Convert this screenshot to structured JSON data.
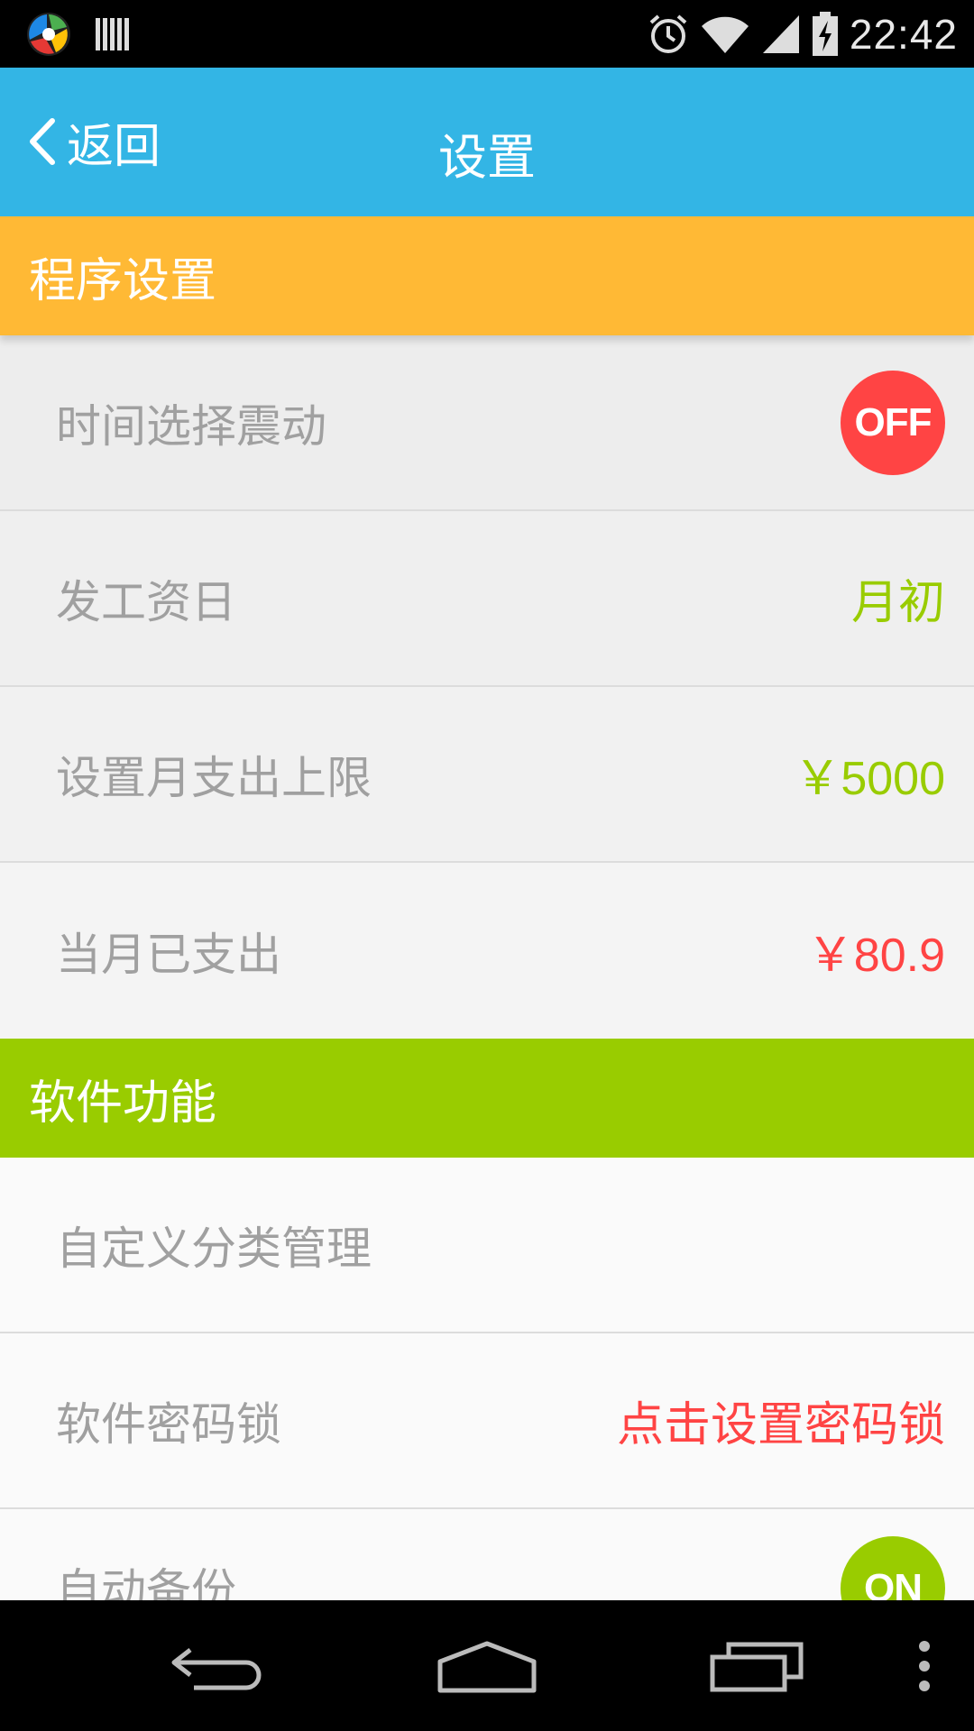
{
  "status_bar": {
    "time": "22:42",
    "icons": [
      "app-logo-icon",
      "barcode-icon",
      "alarm-icon",
      "wifi-icon",
      "signal-icon",
      "battery-charging-icon"
    ]
  },
  "header": {
    "back_label": "返回",
    "title": "设置",
    "background_color": "#33b5e5"
  },
  "sections": [
    {
      "title": "程序设置",
      "color": "#ffb935",
      "items": [
        {
          "label": "时间选择震动",
          "toggle": "OFF"
        },
        {
          "label": "发工资日",
          "value": "月初"
        },
        {
          "label": "设置月支出上限",
          "value": "￥5000"
        },
        {
          "label": "当月已支出",
          "value": "￥80.9"
        }
      ]
    },
    {
      "title": "软件功能",
      "color": "#99cc00",
      "items": [
        {
          "label": "自定义分类管理"
        },
        {
          "label": "软件密码锁",
          "value": "点击设置密码锁"
        },
        {
          "label": "自动备份",
          "toggle": "ON"
        }
      ]
    }
  ],
  "colors": {
    "value_green": "#99cc00",
    "value_red": "#ff4444",
    "label_gray": "#a0a0a0"
  },
  "nav_bar": {
    "icons": [
      "back-nav-icon",
      "home-nav-icon",
      "recents-nav-icon",
      "overflow-menu-icon"
    ]
  }
}
